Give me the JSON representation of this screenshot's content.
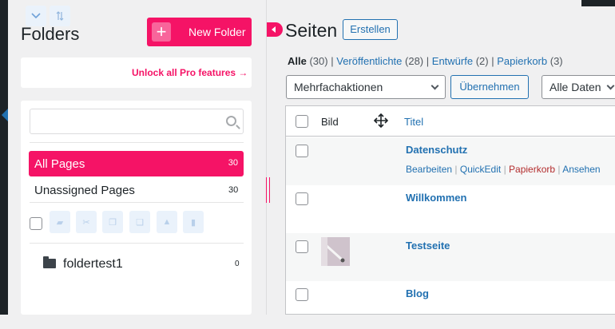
{
  "folders": {
    "title": "Folders",
    "new_folder_label": "New Folder",
    "unlock_label": "Unlock all Pro features →",
    "search_placeholder": "",
    "all_pages": {
      "label": "All Pages",
      "count": "30"
    },
    "unassigned": {
      "label": "Unassigned Pages",
      "count": "30"
    },
    "tree": [
      {
        "name": "foldertest1",
        "count": "0"
      }
    ]
  },
  "page": {
    "title": "Seiten",
    "create_label": "Erstellen",
    "filters": {
      "all": {
        "label": "Alle",
        "count": "(30)"
      },
      "published": {
        "label": "Veröffentlichte",
        "count": "(28)"
      },
      "drafts": {
        "label": "Entwürfe",
        "count": "(2)"
      },
      "trash": {
        "label": "Papierkorb",
        "count": "(3)"
      }
    },
    "bulk_action": "Mehrfachaktionen",
    "apply_label": "Übernehmen",
    "date_filter": "Alle Daten"
  },
  "table": {
    "col_image": "Bild",
    "col_title": "Titel",
    "rows": [
      {
        "title": "Datenschutz",
        "actions": [
          "Bearbeiten",
          "QuickEdit",
          "Papierkorb",
          "Ansehen"
        ]
      },
      {
        "title": "Willkommen"
      },
      {
        "title": "Testseite"
      },
      {
        "title": "Blog"
      }
    ]
  },
  "colors": {
    "accent": "#f51366",
    "link": "#2271b1",
    "delete": "#b32d2e"
  }
}
